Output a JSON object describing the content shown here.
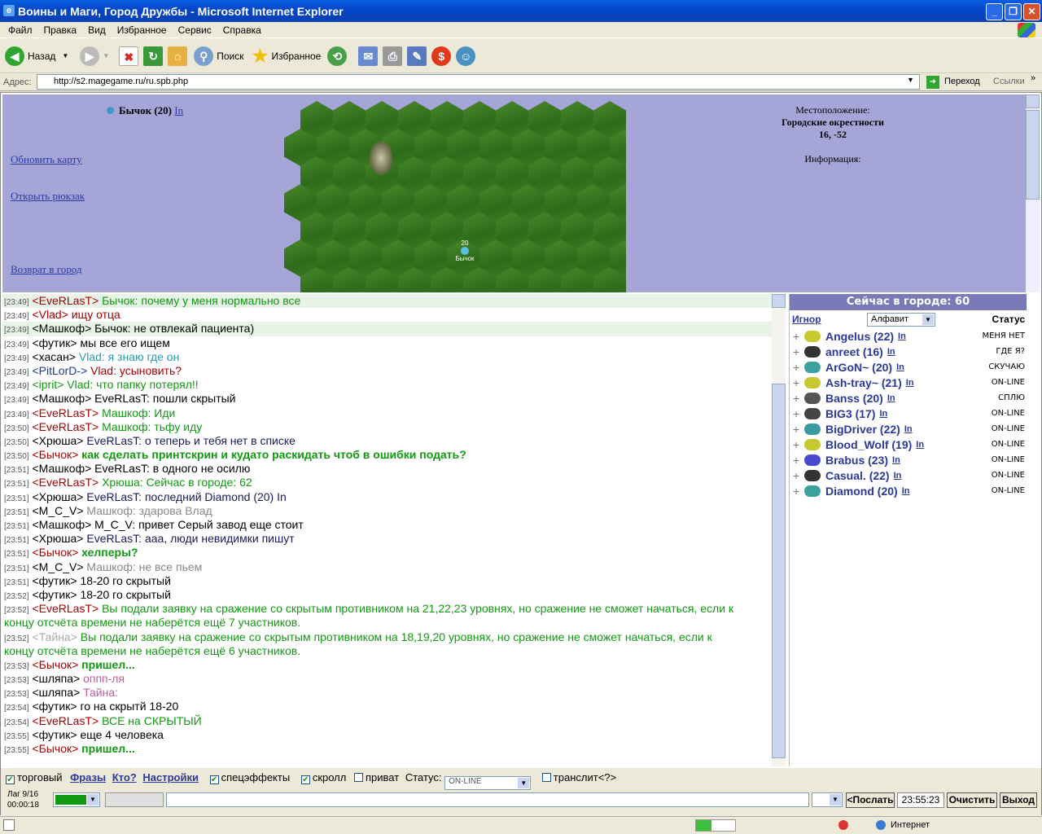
{
  "window": {
    "title": "Воины и Маги, Город Дружбы - Microsoft Internet Explorer"
  },
  "menu": [
    "Файл",
    "Правка",
    "Вид",
    "Избранное",
    "Сервис",
    "Справка"
  ],
  "toolbar": {
    "back": "Назад",
    "search": "Поиск",
    "favorites": "Избранное"
  },
  "address": {
    "label": "Адрес:",
    "url": "http://s2.magegame.ru/ru.spb.php",
    "go": "Переход",
    "links": "Ссылки"
  },
  "game": {
    "player": "Бычок (20)",
    "player_in": "In",
    "links": [
      "Обновить карту",
      "Открыть рюкзак",
      "Возврат в город"
    ],
    "location_label": "Местоположение:",
    "location_name": "Городские окрестности",
    "coords": "16, -52",
    "info_label": "Информация:",
    "map_marker_level": "20",
    "map_marker_name": "Бычок"
  },
  "chat": [
    {
      "time": "[23:49]",
      "nick": "<EveRLasT>",
      "nick_color": "#aa0000",
      "text": " Бычок: почему у меня нормально все",
      "color": "#119911",
      "hl": true
    },
    {
      "time": "[23:49]",
      "nick": "<Vlad>",
      "nick_color": "#aa0000",
      "text": " ищу отца",
      "color": "#aa0000",
      "hl": false
    },
    {
      "time": "[23:49]",
      "nick": "<Машкоф>",
      "nick_color": "#000000",
      "text": " Бычок: не отвлекай пациента)",
      "color": "#000000",
      "hl": true
    },
    {
      "time": "[23:49]",
      "nick": "<футик>",
      "nick_color": "#000000",
      "text": " мы все его ищем",
      "color": "#000000",
      "hl": false
    },
    {
      "time": "[23:49]",
      "nick": "<хасан>",
      "nick_color": "#000000",
      "text": " Vlad: я знаю где он",
      "color": "#2a9ab0",
      "hl": false
    },
    {
      "time": "[23:49]",
      "nick": "<PitLorD->",
      "nick_color": "#1a3a9a",
      "text": " Vlad: усыновить?",
      "color": "#aa0000",
      "hl": false
    },
    {
      "time": "[23:49]",
      "nick": "<iprit>",
      "nick_color": "#119911",
      "text": " Vlad: что папку потерял!!",
      "color": "#119911",
      "hl": false
    },
    {
      "time": "[23:49]",
      "nick": "<Машкоф>",
      "nick_color": "#000000",
      "text": " EveRLasT: пошли скрытый",
      "color": "#000000",
      "hl": false
    },
    {
      "time": "[23:49]",
      "nick": "<EveRLasT>",
      "nick_color": "#aa0000",
      "text": " Машкоф: Иди",
      "color": "#119911",
      "hl": false
    },
    {
      "time": "[23:50]",
      "nick": "<EveRLasT>",
      "nick_color": "#aa0000",
      "text": " Машкоф: тьфу иду",
      "color": "#119911",
      "hl": false
    },
    {
      "time": "[23:50]",
      "nick": "<Хрюша>",
      "nick_color": "#000000",
      "text": " EveRLasT: о теперь и тебя нет в списке",
      "color": "#1a1a5a",
      "hl": false
    },
    {
      "time": "[23:50]",
      "nick": "<Бычок>",
      "nick_color": "#aa0000",
      "text": " как сделать принтскрин и кудато раскидать чтоб в ошибки подать?",
      "color": "#119911",
      "hl": false,
      "bold": true
    },
    {
      "time": "[23:51]",
      "nick": "<Машкоф>",
      "nick_color": "#000000",
      "text": " EveRLasT: в одного не осилю",
      "color": "#000000",
      "hl": false
    },
    {
      "time": "[23:51]",
      "nick": "<EveRLasT>",
      "nick_color": "#aa0000",
      "text": " Хрюша: Сейчас в городе: 62",
      "color": "#119911",
      "hl": false
    },
    {
      "time": "[23:51]",
      "nick": "<Хрюша>",
      "nick_color": "#000000",
      "text": " EveRLasT: последний Diamond (20) In",
      "color": "#1a1a5a",
      "hl": false
    },
    {
      "time": "[23:51]",
      "nick": "<M_C_V>",
      "nick_color": "#000000",
      "text": " Машкоф: здарова Влад",
      "color": "#888888",
      "hl": false
    },
    {
      "time": "[23:51]",
      "nick": "<Машкоф>",
      "nick_color": "#000000",
      "text": " M_C_V: привет Серый завод еще стоит",
      "color": "#000000",
      "hl": false
    },
    {
      "time": "[23:51]",
      "nick": "<Хрюша>",
      "nick_color": "#000000",
      "text": " EveRLasT: ааа, люди невидимки пишут",
      "color": "#1a1a5a",
      "hl": false
    },
    {
      "time": "[23:51]",
      "nick": "<Бычок>",
      "nick_color": "#aa0000",
      "text": " хелперы?",
      "color": "#119911",
      "hl": false,
      "bold": true
    },
    {
      "time": "[23:51]",
      "nick": "<M_C_V>",
      "nick_color": "#000000",
      "text": " Машкоф: не все пьем",
      "color": "#888888",
      "hl": false
    },
    {
      "time": "[23:51]",
      "nick": "<футик>",
      "nick_color": "#000000",
      "text": " 18-20 го скрытый",
      "color": "#000000",
      "hl": false
    },
    {
      "time": "[23:52]",
      "nick": "<футик>",
      "nick_color": "#000000",
      "text": " 18-20 го скрытый",
      "color": "#000000",
      "hl": false
    },
    {
      "time": "[23:52]",
      "nick": "<EveRLasT>",
      "nick_color": "#aa0000",
      "text": " Вы подали заявку на сражение со скрытым противником на 21,22,23 уровнях, но сражение не сможет начаться, если к",
      "color": "#119911",
      "hl": false
    },
    {
      "time": "",
      "nick": "",
      "nick_color": "#aa0000",
      "text": "концу отсчёта времени не наберётся ещё 7 участников.",
      "color": "#119911",
      "hl": false
    },
    {
      "time": "[23:52]",
      "nick": "<Тайна>",
      "nick_color": "#aaaaaa",
      "text": " Вы подали заявку на сражение со скрытым противником на 18,19,20 уровнях, но сражение не сможет начаться, если к",
      "color": "#119911",
      "hl": false
    },
    {
      "time": "",
      "nick": "",
      "nick_color": "#aaaaaa",
      "text": "концу отсчёта времени не наберётся ещё 6 участников.",
      "color": "#119911",
      "hl": false
    },
    {
      "time": "[23:53]",
      "nick": "<Бычок>",
      "nick_color": "#aa0000",
      "text": " пришел...",
      "color": "#119911",
      "hl": false,
      "bold": true
    },
    {
      "time": "[23:53]",
      "nick": "<шляпа>",
      "nick_color": "#000000",
      "text": " оппп-ля",
      "color": "#c05aa0",
      "hl": false
    },
    {
      "time": "[23:53]",
      "nick": "<шляпа>",
      "nick_color": "#000000",
      "text": " Тайна:",
      "color": "#c05aa0",
      "hl": false
    },
    {
      "time": "[23:54]",
      "nick": "<футик>",
      "nick_color": "#000000",
      "text": " го на скрытй 18-20",
      "color": "#000000",
      "hl": false
    },
    {
      "time": "[23:54]",
      "nick": "<EveRLasT>",
      "nick_color": "#aa0000",
      "text": " ВСЕ на СКРЫТЫЙ",
      "color": "#119911",
      "hl": false
    },
    {
      "time": "[23:55]",
      "nick": "<футик>",
      "nick_color": "#000000",
      "text": " еще 4 человека",
      "color": "#000000",
      "hl": false
    },
    {
      "time": "[23:55]",
      "nick": "<Бычок>",
      "nick_color": "#aa0000",
      "text": " пришел...",
      "color": "#119911",
      "hl": false,
      "bold": true
    }
  ],
  "users_panel": {
    "title": "Сейчас в городе: 60",
    "ignore": "Игнор",
    "sort": "Алфавит",
    "status_col": "Статус",
    "users": [
      {
        "name": "Angelus (22)",
        "in": "In",
        "status": "МЕНЯ НЕТ"
      },
      {
        "name": "anreet (16)",
        "in": "In",
        "status": "ГДЕ Я?"
      },
      {
        "name": "ArGoN~ (20)",
        "in": "In",
        "status": "СКУЧАЮ"
      },
      {
        "name": "Ash-tray~ (21)",
        "in": "In",
        "status": "ON-LINE"
      },
      {
        "name": "Banss (20)",
        "in": "In",
        "status": "СПЛЮ"
      },
      {
        "name": "BIG3 (17)",
        "in": "In",
        "status": "ON-LINE"
      },
      {
        "name": "BigDriver (22)",
        "in": "In",
        "status": "ON-LINE"
      },
      {
        "name": "Blood_Wolf (19)",
        "in": "In",
        "status": "ON-LINE"
      },
      {
        "name": "Brabus (23)",
        "in": "In",
        "status": "ON-LINE"
      },
      {
        "name": "Casual. (22)",
        "in": "In",
        "status": "ON-LINE"
      },
      {
        "name": "Diamond (20)",
        "in": "In",
        "status": "ON-LINE"
      }
    ]
  },
  "controls": {
    "trade": "торговый",
    "phrases": "Фразы",
    "who": "Кто?",
    "settings": "Настройки",
    "effects": "спецэффекты",
    "scroll": "скролл",
    "private": "приват",
    "status_label": "Статус:",
    "status_value": "ON-LINE",
    "translit": "транслит",
    "translit_help": "<?>",
    "lag": "Лаг 9/16",
    "timer": "00:00:18",
    "send": "<Послать",
    "clock": "23:55:23",
    "clear": "Очистить",
    "exit": "Выход"
  },
  "statusbar": {
    "zone": "Интернет"
  }
}
